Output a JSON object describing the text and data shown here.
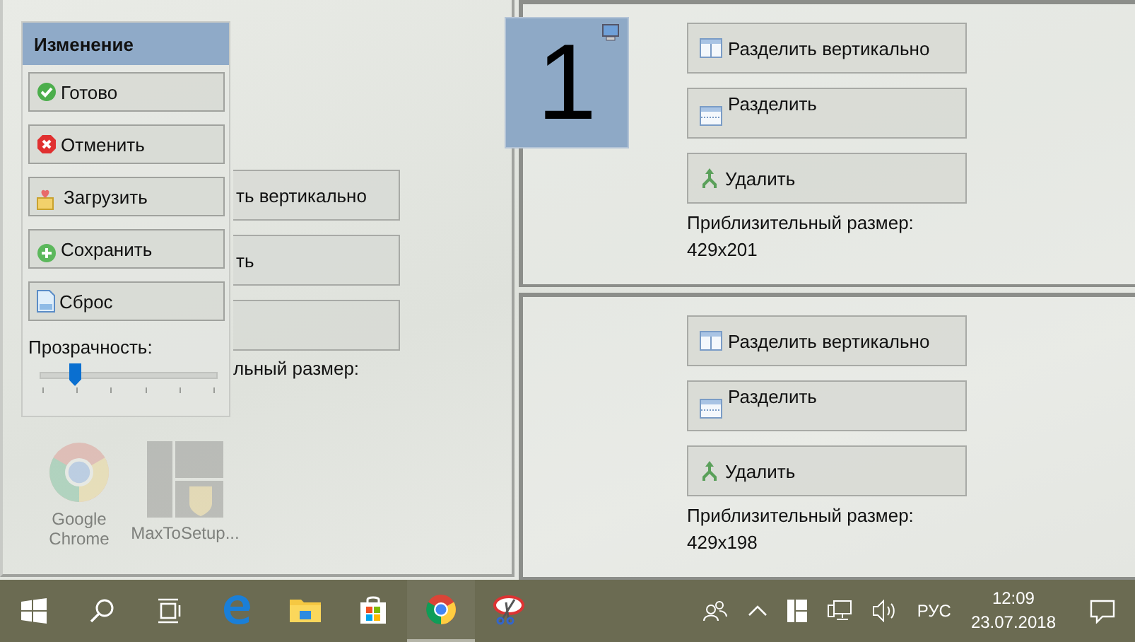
{
  "desktop_icons": [
    {
      "kind": "chrome",
      "label": "Google Chrome"
    },
    {
      "kind": "maxto",
      "label": "MaxToSetup..."
    }
  ],
  "left_pane": {
    "buttons": [
      "ть вертикально",
      "ть"
    ],
    "size_label": "льный размер:"
  },
  "edit_panel": {
    "title": "Изменение",
    "buttons": [
      {
        "kind": "done",
        "label": "Готово"
      },
      {
        "kind": "cancel",
        "label": "Отменить"
      },
      {
        "kind": "load",
        "label": "Загрузить"
      },
      {
        "kind": "save",
        "label": "Сохранить"
      },
      {
        "kind": "reset",
        "label": "Сброс"
      }
    ],
    "opacity_label": "Прозрачность:",
    "opacity": {
      "level": 0.18
    }
  },
  "monitor_tile": {
    "number": "1"
  },
  "panes": [
    {
      "buttons": [
        {
          "kind": "split-vertical",
          "label": "Разделить вертикально"
        },
        {
          "kind": "split",
          "label": "Разделить"
        },
        {
          "kind": "delete",
          "label": "Удалить"
        }
      ],
      "size_label": "Приблизительный размер:",
      "size": "429x201"
    },
    {
      "buttons": [
        {
          "kind": "split-vertical",
          "label": "Разделить вертикально"
        },
        {
          "kind": "split",
          "label": "Разделить"
        },
        {
          "kind": "delete",
          "label": "Удалить"
        }
      ],
      "size_label": "Приблизительный размер:",
      "size": "429x198"
    }
  ],
  "taskbar": {
    "apps": [
      {
        "kind": "edge",
        "selected": false
      },
      {
        "kind": "explorer",
        "selected": false
      },
      {
        "kind": "store",
        "selected": false
      },
      {
        "kind": "chrome",
        "selected": true
      },
      {
        "kind": "scissors",
        "selected": false
      }
    ],
    "language": "РУС",
    "time": "12:09",
    "date": "23.07.2018"
  }
}
